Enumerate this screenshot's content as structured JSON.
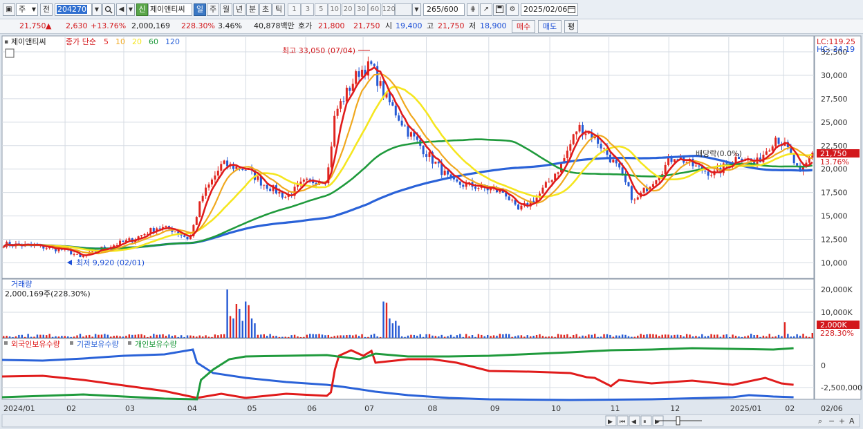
{
  "toolbar": {
    "period": "주",
    "prefix": "전",
    "code": "204270",
    "credit_badge": "신",
    "stock_name": "제이앤티씨",
    "tabs": [
      "일",
      "주",
      "월",
      "년",
      "분",
      "초",
      "틱"
    ],
    "active_tab": "일",
    "minute_periods": [
      "1",
      "3",
      "5",
      "10",
      "20",
      "30",
      "60",
      "120"
    ],
    "count": "265",
    "total": "/600",
    "date": "2025/02/06"
  },
  "quote": {
    "price": "21,750",
    "direction_arrow": "▲",
    "change": "2,630",
    "change_pct": "+13.76%",
    "volume": "2,000,169",
    "volume_ratio": "228.30%",
    "turnover": "3.46%",
    "amount": "40,878백만",
    "ask_label": "호가",
    "ask": "21,800",
    "bid": "21,750",
    "open_label": "시",
    "open": "19,400",
    "high_label": "고",
    "high": "21,750",
    "low_label": "저",
    "low": "18,900",
    "buy_label": "매수",
    "sell_label": "매도",
    "avg_label": "평"
  },
  "price_panel": {
    "stock_tag": "제이앤티씨",
    "ma_label": "종가 단순",
    "ma_periods": [
      "5",
      "10",
      "20",
      "60",
      "120"
    ],
    "ma_colors": [
      "#e01b1b",
      "#f0a81e",
      "#f5e61f",
      "#1f9a3c",
      "#2a62d8"
    ],
    "lc": "LC:119.25",
    "hc": "HC:-34.19",
    "high_note": "최고 33,050 (07/04)",
    "low_note": "최저 9,920 (02/01)",
    "dividend_note": "배당락(0.0%)",
    "current_price": "21,750",
    "current_pct": "13.76%",
    "y_ticks": [
      "32,500",
      "30,000",
      "27,500",
      "25,000",
      "22,500",
      "20,000",
      "17,500",
      "15,000",
      "12,500",
      "10,000"
    ]
  },
  "volume_panel": {
    "title": "거래량",
    "value": "2,000,169주(228.30%)",
    "y_ticks": [
      "20,000K",
      "10,000K"
    ],
    "current": "2,000K",
    "current_pct": "228.30%"
  },
  "holdings_panel": {
    "legend": [
      "외국인보유수량",
      "기관보유수량",
      "개인보유수량"
    ],
    "colors": [
      "#e01b1b",
      "#2a62d8",
      "#1f9a3c"
    ],
    "y_ticks": [
      "0",
      "-2,500,000"
    ]
  },
  "x_axis": {
    "labels": [
      "2024/01",
      "02",
      "03",
      "04",
      "05",
      "06",
      "07",
      "08",
      "09",
      "10",
      "11",
      "12",
      "2025/01",
      "02",
      "02/06"
    ]
  },
  "chart_data": {
    "type": "line",
    "title": "",
    "x": [
      "2024/01",
      "02",
      "03",
      "04",
      "05",
      "06",
      "07",
      "08",
      "09",
      "10",
      "11",
      "12",
      "2025/01",
      "02"
    ],
    "ylim": [
      9000,
      33500
    ],
    "series": [
      {
        "name": "종가",
        "values": [
          12000,
          11000,
          12500,
          13500,
          20500,
          17000,
          19500,
          30500,
          20000,
          17000,
          23000,
          16500,
          21000,
          20000,
          22000,
          21750
        ]
      },
      {
        "name": "120",
        "values": [
          11000,
          11500,
          12000,
          12500,
          13500,
          14500,
          16000,
          18500,
          20000,
          20300,
          21000,
          21200,
          21000,
          20200,
          20000,
          20100
        ]
      },
      {
        "name": "60",
        "values": [
          12800,
          12500,
          12400,
          13000,
          15000,
          16500,
          19000,
          22000,
          22700,
          22600,
          20000,
          19800,
          20000,
          20300,
          20100,
          20200
        ]
      }
    ],
    "volume_values_k": [
      600,
      700,
      1200,
      900,
      20000,
      3000,
      2500,
      15000,
      2000,
      1200,
      1800,
      1500,
      900,
      1100,
      5000,
      2000
    ]
  }
}
